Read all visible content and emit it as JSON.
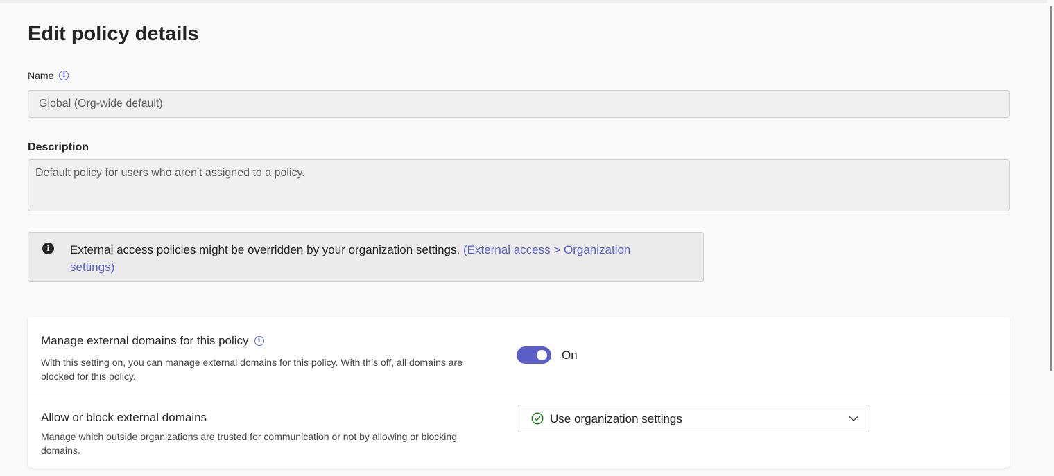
{
  "page": {
    "title": "Edit policy details"
  },
  "name_field": {
    "label": "Name",
    "value": "Global (Org-wide default)"
  },
  "description_field": {
    "label": "Description",
    "value": "Default policy for users who aren't assigned to a policy."
  },
  "notice": {
    "text": "External access policies might be overridden by your organization settings. ",
    "link_text": "(External access > Organization settings)"
  },
  "settings": {
    "manage_domains": {
      "title": "Manage external domains for this policy",
      "description": "With this setting on, you can manage external domains for this policy. With this off, all domains are blocked for this policy.",
      "toggle_state": "On",
      "toggle_on": true
    },
    "allow_block_domains": {
      "title": "Allow or block external domains",
      "description": "Manage which outside organizations are trusted for communication or not by allowing or blocking domains.",
      "selected_option": "Use organization settings"
    }
  },
  "colors": {
    "accent": "#5b5fc7",
    "success": "#107c10",
    "field_bg": "#f0f0f0",
    "page_bg": "#fafafa"
  },
  "icons": {
    "name_info": "info-icon",
    "notice": "info-filled-icon",
    "manage_info": "info-icon",
    "dropdown_check": "check-circle-icon",
    "dropdown_chevron": "chevron-down-icon"
  }
}
